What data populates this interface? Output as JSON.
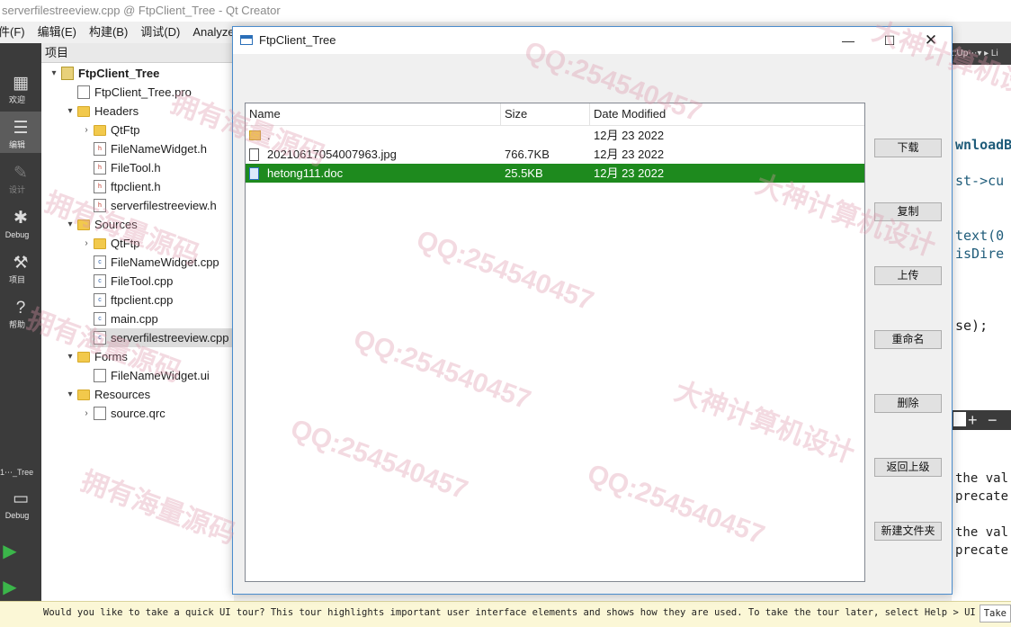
{
  "window": {
    "title": "serverfilestreeview.cpp @ FtpClient_Tree - Qt Creator"
  },
  "menu": [
    "件(F)",
    "编辑(E)",
    "构建(B)",
    "调试(D)",
    "Analyze"
  ],
  "mode_bar": {
    "items": [
      {
        "icon": "grid-icon",
        "label": "欢迎"
      },
      {
        "icon": "edit-icon",
        "label": "编辑"
      },
      {
        "icon": "pencil-icon",
        "label": "设计"
      },
      {
        "icon": "bug-icon",
        "label": "Debug"
      },
      {
        "icon": "wrench-icon",
        "label": "项目"
      },
      {
        "icon": "help-icon",
        "label": "帮助"
      }
    ],
    "kit_label": "1⋯_Tree",
    "kit_mode": "Debug"
  },
  "project_panel": {
    "header": "项目",
    "tree": [
      {
        "label": "FtpClient_Tree",
        "icon": "project-icon",
        "level": 0,
        "arrow": "▾",
        "bold": true
      },
      {
        "label": "FtpClient_Tree.pro",
        "icon": "pro-file-icon",
        "level": 1,
        "arrow": ""
      },
      {
        "label": "Headers",
        "icon": "headers-folder-icon",
        "level": 1,
        "arrow": "▾"
      },
      {
        "label": "QtFtp",
        "icon": "folder-icon",
        "level": 2,
        "arrow": "›"
      },
      {
        "label": "FileNameWidget.h",
        "icon": "header-file-icon",
        "level": 2,
        "arrow": ""
      },
      {
        "label": "FileTool.h",
        "icon": "header-file-icon",
        "level": 2,
        "arrow": ""
      },
      {
        "label": "ftpclient.h",
        "icon": "header-file-icon",
        "level": 2,
        "arrow": ""
      },
      {
        "label": "serverfilestreeview.h",
        "icon": "header-file-icon",
        "level": 2,
        "arrow": ""
      },
      {
        "label": "Sources",
        "icon": "sources-folder-icon",
        "level": 1,
        "arrow": "▾"
      },
      {
        "label": "QtFtp",
        "icon": "folder-icon",
        "level": 2,
        "arrow": "›"
      },
      {
        "label": "FileNameWidget.cpp",
        "icon": "cpp-file-icon",
        "level": 2,
        "arrow": ""
      },
      {
        "label": "FileTool.cpp",
        "icon": "cpp-file-icon",
        "level": 2,
        "arrow": ""
      },
      {
        "label": "ftpclient.cpp",
        "icon": "cpp-file-icon",
        "level": 2,
        "arrow": ""
      },
      {
        "label": "main.cpp",
        "icon": "cpp-file-icon",
        "level": 2,
        "arrow": ""
      },
      {
        "label": "serverfilestreeview.cpp",
        "icon": "cpp-file-icon",
        "level": 2,
        "arrow": "",
        "selected": true
      },
      {
        "label": "Forms",
        "icon": "forms-folder-icon",
        "level": 1,
        "arrow": "▾"
      },
      {
        "label": "FileNameWidget.ui",
        "icon": "ui-file-icon",
        "level": 2,
        "arrow": ""
      },
      {
        "label": "Resources",
        "icon": "resources-folder-icon",
        "level": 1,
        "arrow": "▾"
      },
      {
        "label": "source.qrc",
        "icon": "qrc-file-icon",
        "level": 2,
        "arrow": "›"
      }
    ]
  },
  "editor": {
    "tab_fragment": "::Up⋯▾ ▸ Li",
    "code_lines": [
      "wnloadBu",
      "st->cu",
      "text(0",
      "isDire",
      "se);"
    ]
  },
  "lower_panel": {
    "lines": [
      "the val",
      "precate",
      "the val",
      "precate"
    ]
  },
  "status_bar": {
    "message": "Would you like to take a quick UI tour? This tour highlights important user interface elements and shows how they are used. To take the tour later, select Help > UI Tour.",
    "take_button": "Take"
  },
  "dialog": {
    "title": "FtpClient_Tree",
    "columns": [
      "Name",
      "Size",
      "Date Modified"
    ],
    "files": [
      {
        "name": ".",
        "size": "",
        "date": "12月 23 2022",
        "icon": "folder-icon",
        "selected": false
      },
      {
        "name": "20210617054007963.jpg",
        "size": "766.7KB",
        "date": "12月 23 2022",
        "icon": "file-icon",
        "selected": false
      },
      {
        "name": "hetong111.doc",
        "size": "25.5KB",
        "date": "12月 23 2022",
        "icon": "doc-file-icon",
        "selected": true
      }
    ],
    "buttons": [
      "下载",
      "复制",
      "上传",
      "重命名",
      "删除",
      "返回上级",
      "新建文件夹"
    ]
  },
  "watermarks": [
    "拥有海量源码",
    "QQ:254540457",
    "大神计算机设计",
    "拥有海量源码",
    "QQ:254540457",
    "大神计算机设计",
    "拥有海量源码",
    "QQ:254540457",
    "大神计算机设计",
    "QQ:254540457",
    "拥有海量源码",
    "QQ:254540457"
  ]
}
